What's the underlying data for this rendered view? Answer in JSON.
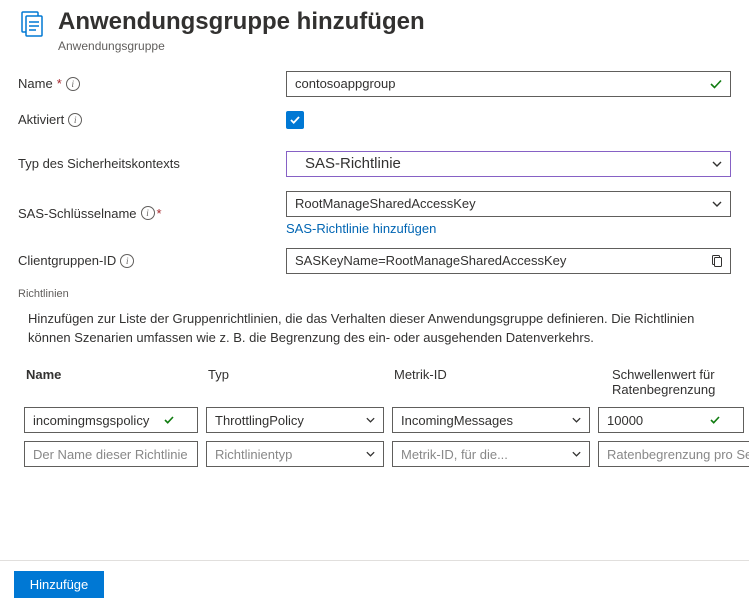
{
  "header": {
    "title": "Anwendungsgruppe hinzufügen",
    "subtitle": "Anwendungsgruppe"
  },
  "fields": {
    "name": {
      "label": "Name",
      "value": "contosoappgroup"
    },
    "activated": {
      "label": "Aktiviert",
      "checked": true
    },
    "securityType": {
      "label": "Typ des Sicherheitskontexts",
      "value": "SAS-Richtlinie"
    },
    "sasKeyName": {
      "label": "SAS-Schlüsselname",
      "value": "RootManageSharedAccessKey",
      "addLink": "SAS-Richtlinie hinzufügen"
    },
    "clientGroupId": {
      "label": "Clientgruppen-ID",
      "value": "SASKeyName=RootManageSharedAccessKey"
    }
  },
  "policies": {
    "sectionLabel": "Richtlinien",
    "description": "Hinzufügen zur Liste der Gruppenrichtlinien, die das Verhalten dieser Anwendungsgruppe definieren. Die Richtlinien können Szenarien umfassen wie z. B. die Begrenzung des ein- oder ausgehenden Datenverkehrs.",
    "columns": {
      "name": "Name",
      "type": "Typ",
      "metricId": "Metrik-ID",
      "threshold": "Schwellenwert für Ratenbegrenzung"
    },
    "rows": [
      {
        "name": "incomingmsgspolicy",
        "type": "ThrottlingPolicy",
        "metricId": "IncomingMessages",
        "threshold": "10000"
      }
    ],
    "placeholders": {
      "name": "Der Name dieser Richtlinie",
      "type": "Richtlinientyp",
      "metricId": "Metrik-ID, für die...",
      "threshold": "Ratenbegrenzung pro Sekunde"
    }
  },
  "footer": {
    "submit": "Hinzufüge"
  }
}
